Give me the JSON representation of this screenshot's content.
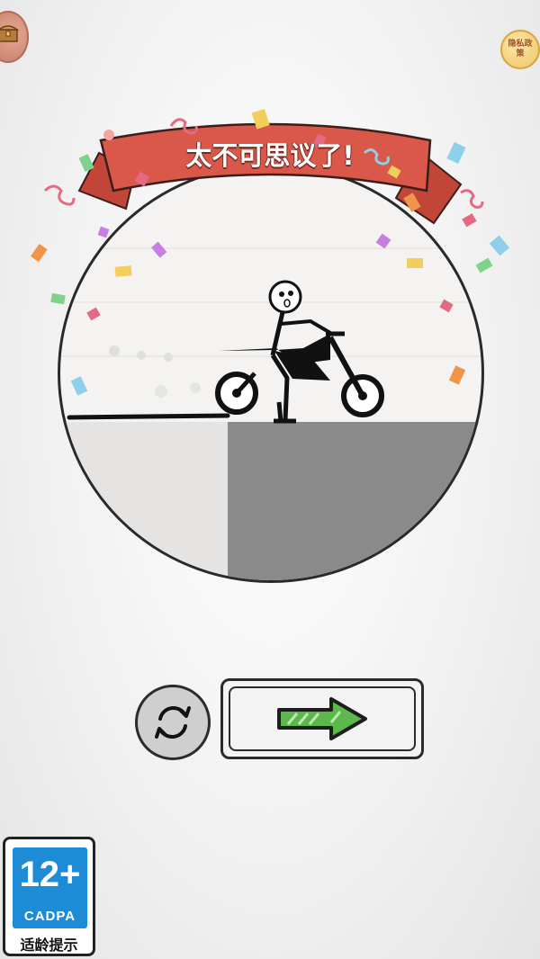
{
  "banner": {
    "title": "太不可思议了!",
    "color": "#d9584a"
  },
  "top_left": {
    "icon": "treasure-chest-icon"
  },
  "top_right": {
    "label": "隐私政策",
    "icon": "privacy-icon"
  },
  "buttons": {
    "retry_icon": "refresh-icon",
    "next_icon": "arrow-right-icon",
    "arrow_color": "#5cb84a"
  },
  "age_rating": {
    "rating": "12+",
    "org": "CADPA",
    "tip": "适龄提示",
    "color": "#1e8bd6"
  }
}
